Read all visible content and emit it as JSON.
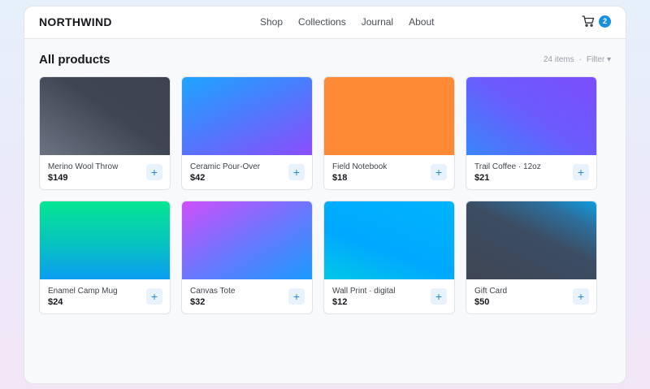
{
  "header": {
    "brand": "NORTHWIND",
    "nav": [
      "Shop",
      "Collections",
      "Journal",
      "About"
    ],
    "cart_count": "2"
  },
  "page": {
    "title": "All products",
    "item_count": "24 items",
    "separator": "·",
    "filter_label": "Filter ▾"
  },
  "products": [
    {
      "name": "Merino Wool Throw",
      "price": "$149",
      "add_label": "+",
      "gradient": "linear-gradient(215deg, #3d4351 0%, #3e4653 45%, #6c7483 100%)"
    },
    {
      "name": "Ceramic Pour-Over",
      "price": "$42",
      "add_label": "+",
      "gradient": "linear-gradient(155deg, #1ea4ff 0%, #4a7dfd 45%, #8b4dfb 100%)"
    },
    {
      "name": "Field Notebook",
      "price": "$18",
      "add_label": "+",
      "gradient": "linear-gradient(180deg, #ff8a36 0%, #ff8a36 100%)"
    },
    {
      "name": "Trail Coffee · 12oz",
      "price": "$21",
      "add_label": "+",
      "gradient": "linear-gradient(215deg, #7c4dfc 0%, #6a5cfd 50%, #3a86f9 100%)"
    },
    {
      "name": "Enamel Camp Mug",
      "price": "$24",
      "add_label": "+",
      "gradient": "linear-gradient(180deg, #05e693 0%, #06c2c0 55%, #0a9df2 100%)"
    },
    {
      "name": "Canvas Tote",
      "price": "$32",
      "add_label": "+",
      "gradient": "linear-gradient(150deg, #cf4ffb 0%, #6d75fd 50%, #1b9bff 100%)"
    },
    {
      "name": "Wall Print · digital",
      "price": "$12",
      "add_label": "+",
      "gradient": "linear-gradient(200deg, #00b4fd 0%, #00a8ff 60%, #00c8e6 100%)"
    },
    {
      "name": "Gift Card",
      "price": "$50",
      "add_label": "+",
      "gradient": "linear-gradient(205deg, #0e9de0 0%, #2d6e9b 20%, #3c4d63 45%, #3e4653 100%)"
    }
  ],
  "colors": {
    "accent": "#1a8fe0",
    "add_button_bg": "#e8f2fc"
  },
  "icons": {
    "cart": "cart-icon"
  }
}
